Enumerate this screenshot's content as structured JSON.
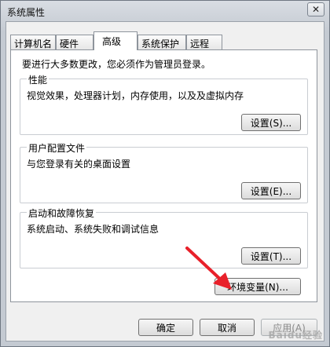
{
  "window": {
    "title": "系统属性",
    "close_glyph": "✕"
  },
  "tabs": [
    {
      "label": "计算机名"
    },
    {
      "label": "硬件"
    },
    {
      "label": "高级"
    },
    {
      "label": "系统保护"
    },
    {
      "label": "远程"
    }
  ],
  "advanced": {
    "notice": "要进行大多数更改，您必须作为管理员登录。",
    "performance": {
      "title": "性能",
      "description": "视觉效果，处理器计划，内存使用，以及及虚拟内存",
      "button": "设置(S)..."
    },
    "user_profiles": {
      "title": "用户配置文件",
      "description": "与您登录有关的桌面设置",
      "button": "设置(E)..."
    },
    "startup_recovery": {
      "title": "启动和故障恢复",
      "description": "系统启动、系统失败和调试信息",
      "button": "设置(T)..."
    },
    "env_button": "环境变量(N)..."
  },
  "footer": {
    "ok": "确定",
    "cancel": "取消",
    "apply": "应用(A)"
  },
  "colors": {
    "annotation_arrow": "#e8202a"
  },
  "watermark": "Baidu经验"
}
